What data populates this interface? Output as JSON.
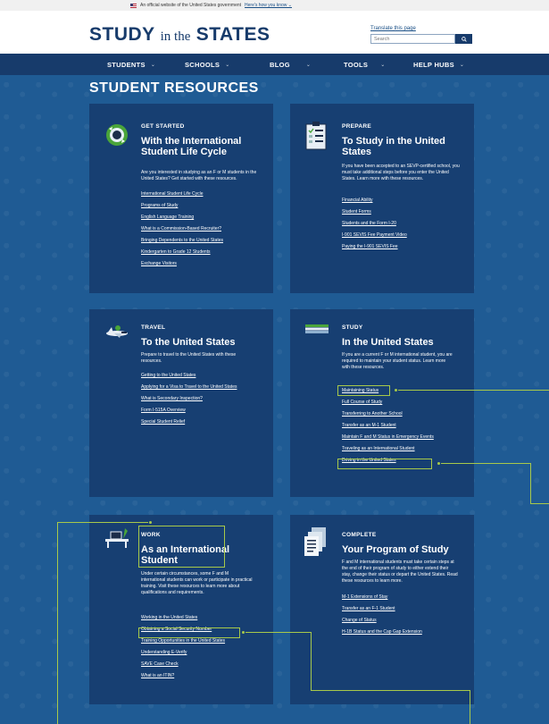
{
  "banner": {
    "text": "An official website of the United States government",
    "link": "Here's how you know ⌄"
  },
  "header": {
    "logo_main": "STUDY",
    "logo_mid": "in the",
    "logo_end": "STATES",
    "translate": "Translate this page",
    "search_placeholder": "Search"
  },
  "nav": {
    "items": [
      {
        "label": "STUDENTS",
        "chev": "⌄"
      },
      {
        "label": "SCHOOLS",
        "chev": "⌄"
      },
      {
        "label": "BLOG",
        "chev": "⌄"
      },
      {
        "label": "TOOLS",
        "chev": "⌄"
      },
      {
        "label": "HELP HUBS",
        "chev": "⌄"
      }
    ]
  },
  "page_title": "STUDENT RESOURCES",
  "cards": {
    "get_started": {
      "eyebrow": "GET STARTED",
      "heading": "With the International Student Life Cycle",
      "desc": "Are you interested in studying as an F or M students in the United States? Get started with these resources.",
      "links": [
        "International Student Life Cycle",
        "Programs of Study",
        "English Language Training",
        "What is a Commission-Based Recruiter?",
        "Bringing Dependents to the United States",
        "Kindergarten to Grade 12 Students",
        "Exchange Visitors"
      ]
    },
    "prepare": {
      "eyebrow": "PREPARE",
      "heading": "To Study in the United States",
      "desc": "If you have been accepted to an SEVP-certified school, you must take additional steps before you enter the United States. Learn more with these resources.",
      "links": [
        "Financial Ability",
        "Student Forms",
        "Students and the Form I-20",
        "I-901 SEVIS Fee Payment Video",
        "Paying the I-901 SEVIS Fee"
      ]
    },
    "travel": {
      "eyebrow": "TRAVEL",
      "heading": "To the United States",
      "desc": "Prepare to travel to the United States with these resources.",
      "links": [
        "Getting to the United States",
        "Applying for a Visa to Travel to the United States",
        "What is Secondary Inspection?",
        "Form I-515A Overview",
        "Special Student Relief"
      ]
    },
    "study": {
      "eyebrow": "STUDY",
      "heading": "In the United States",
      "desc": "If you are a current F or M international student, you are required to maintain your student status. Learn more with these resources.",
      "links": [
        "Maintaining Status",
        "Full Course of Study",
        "Transferring to Another School",
        "Transfer as an M-1 Student",
        "Maintain F and M Status in Emergency Events",
        "Traveling as an International Student",
        "Driving in the United States"
      ]
    },
    "work": {
      "eyebrow": "WORK",
      "heading": "As an International Student",
      "desc": "Under certain circumstances, some F and M international students can work or participate in practical training. Visit these resources to learn more about qualifications and requirements.",
      "links": [
        "Working in the United States",
        "Obtaining a Social Security Number",
        "Training Opportunities in the United States",
        "Understanding E-Verify",
        "SAVE Case Check",
        "What is an ITIN?"
      ]
    },
    "complete": {
      "eyebrow": "COMPLETE",
      "heading": "Your Program of Study",
      "desc": "F and M international students must take certain steps at the end of their program of study to either extend their stay, change their status or depart the United States. Read these resources to learn more.",
      "links": [
        "M-1 Extensions of Stay",
        "Transfer as an F-1 Student",
        "Change of Status",
        "H-1B Status and the Cap Gap Extension"
      ]
    }
  },
  "colors": {
    "background": "#1f5b94",
    "card": "#173f72",
    "nav": "#173b6b",
    "highlight": "#a8c94a"
  }
}
